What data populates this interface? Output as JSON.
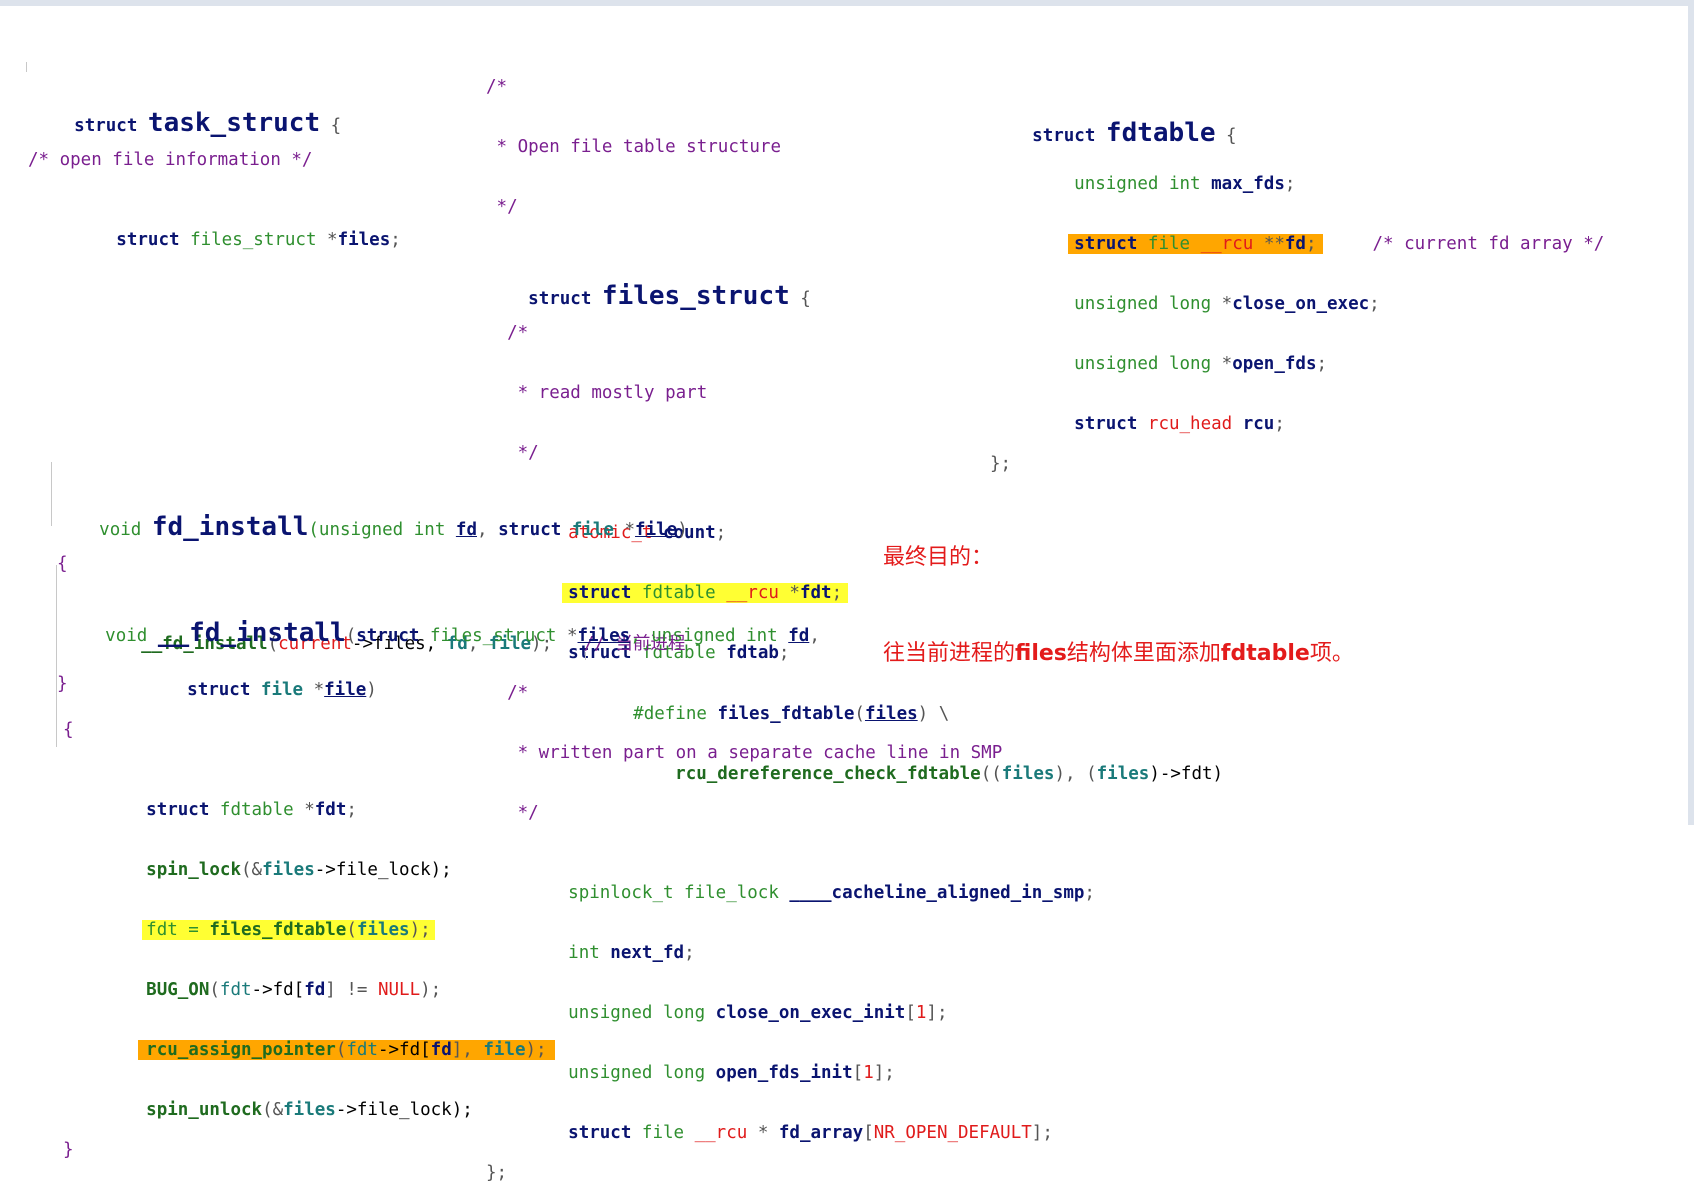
{
  "task_struct": {
    "lines": [
      [
        "struct ",
        "task_struct",
        " {"
      ],
      [
        "/* open file information */"
      ],
      [
        "    struct ",
        "files_struct",
        " *",
        "files",
        ";"
      ]
    ]
  },
  "files_struct": {
    "comment": [
      "/*",
      " * Open file table structure",
      " */"
    ],
    "head": [
      "struct ",
      "files_struct",
      " {"
    ],
    "c1": [
      "  /*",
      "   * read mostly part",
      "   */"
    ],
    "f1": [
      "atomic_t",
      " count",
      ";"
    ],
    "f2": [
      "struct",
      " fdtable",
      " __rcu",
      " *",
      "fdt",
      ";"
    ],
    "f3": [
      "struct",
      " fdtable",
      " fdtab",
      ";"
    ],
    "c2": [
      "  /*",
      "   * written part on a separate cache line in SMP",
      "   */"
    ],
    "f4": [
      "spinlock_t file_lock",
      " ____cacheline_aligned_in_smp",
      ";"
    ],
    "f5": [
      "int",
      " next_fd",
      ";"
    ],
    "f6": [
      "unsigned long",
      " close_on_exec_init",
      "[",
      "1",
      "];"
    ],
    "f7": [
      "unsigned long",
      " open_fds_init",
      "[",
      "1",
      "];"
    ],
    "f8": [
      "struct",
      " file",
      " __rcu",
      " * ",
      "fd_array",
      "[",
      "NR_OPEN_DEFAULT",
      "];"
    ],
    "close": "};"
  },
  "fdtable": {
    "head": [
      "struct ",
      "fdtable",
      " {"
    ],
    "f1": [
      "unsigned int",
      " max_fds",
      ";"
    ],
    "f2": [
      "struct",
      " file",
      " __rcu",
      " **",
      "fd",
      ";"
    ],
    "f2_comment": "/* current fd array */",
    "f3": [
      "unsigned long",
      " *",
      "close_on_exec",
      ";"
    ],
    "f4": [
      "unsigned long",
      " *",
      "open_fds",
      ";"
    ],
    "f5": [
      "struct",
      " rcu_head",
      " rcu",
      ";"
    ],
    "close": "};"
  },
  "fd_install": {
    "sig": [
      "void ",
      "fd_install",
      "(unsigned int ",
      "fd",
      ", ",
      "struct",
      " file",
      " *",
      "file",
      ")"
    ],
    "open": "{",
    "body": [
      "__fd_install",
      "(",
      "current",
      "->files, ",
      "fd",
      ", ",
      "file",
      ");",
      "   // 当前进程"
    ],
    "close": "}"
  },
  "__fd_install": {
    "sig1": [
      "void ",
      "__fd_install",
      "(",
      "struct",
      " files_struct",
      " *",
      "files",
      ", unsigned int ",
      "fd",
      ","
    ],
    "sig2": [
      "struct",
      " file",
      " *",
      "file",
      ")"
    ],
    "open": "{",
    "l1": [
      "struct",
      " fdtable",
      " *",
      "fdt",
      ";"
    ],
    "l2": [
      "spin_lock",
      "(&",
      "files",
      "->file_lock);"
    ],
    "l3": [
      "fdt = ",
      "files_fdtable",
      "(",
      "files",
      ");"
    ],
    "l4": [
      "BUG_ON",
      "(",
      "fdt",
      "->fd[",
      "fd",
      "] != ",
      "NULL",
      ");"
    ],
    "l5": [
      "rcu_assign_pointer",
      "(",
      "fdt",
      "->fd[",
      "fd",
      "], ",
      "file",
      ");"
    ],
    "l6": [
      "spin_unlock",
      "(&",
      "files",
      "->file_lock);"
    ],
    "close": "}"
  },
  "define": {
    "l1": [
      "#define ",
      "files_fdtable",
      "(",
      "files",
      ") \\"
    ],
    "l2": [
      "rcu_dereference_check_fdtable",
      "((",
      "files",
      "), (",
      "files",
      ")->fdt)"
    ]
  },
  "note": {
    "line1": "最终目的：",
    "line2_a": "往当前进程的",
    "line2_b": "files",
    "line2_c": "结构体里面添加",
    "line2_d": "fdtable",
    "line2_e": "项。"
  },
  "colors": {
    "keyword": "#0a1470",
    "type": "#2f8f2f",
    "comment": "#7a1f8f",
    "literal": "#e01b1b",
    "highlight_yellow": "#ffff33",
    "highlight_orange": "#ffa600",
    "note": "#e31b1b"
  }
}
